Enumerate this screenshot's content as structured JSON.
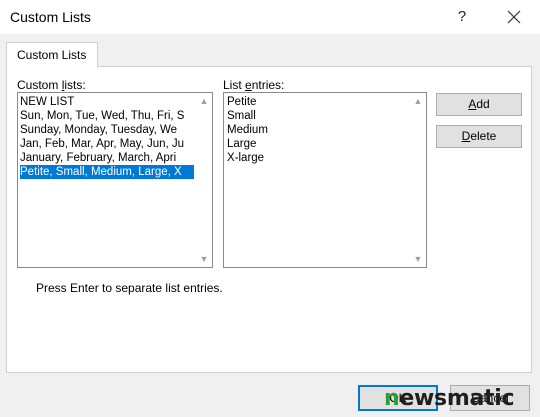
{
  "window": {
    "title": "Custom Lists",
    "help_label": "?"
  },
  "tabs": [
    {
      "label": "Custom Lists"
    }
  ],
  "custom_lists": {
    "label_prefix": "Custom ",
    "label_accel": "l",
    "label_suffix": "ists:",
    "items": [
      {
        "label": "NEW LIST",
        "selected": false
      },
      {
        "label": "Sun, Mon, Tue, Wed, Thu, Fri, S",
        "selected": false
      },
      {
        "label": "Sunday, Monday, Tuesday, We",
        "selected": false
      },
      {
        "label": "Jan, Feb, Mar, Apr, May, Jun, Ju",
        "selected": false
      },
      {
        "label": "January, February, March, Apri",
        "selected": false
      },
      {
        "label": "Petite, Small, Medium, Large, X",
        "selected": true
      }
    ]
  },
  "list_entries": {
    "label_prefix": "List ",
    "label_accel": "e",
    "label_suffix": "ntries:",
    "items": [
      "Petite",
      "Small",
      "Medium",
      "Large",
      "X-large"
    ]
  },
  "buttons": {
    "add_accel": "A",
    "add_rest": "dd",
    "delete_accel": "D",
    "delete_rest": "elete"
  },
  "note": "Press Enter to separate list entries.",
  "footer": {
    "ok_label": "OK",
    "cancel_label": "Cancel"
  },
  "watermark": {
    "first": "n",
    "rest": "ewsmatic"
  }
}
